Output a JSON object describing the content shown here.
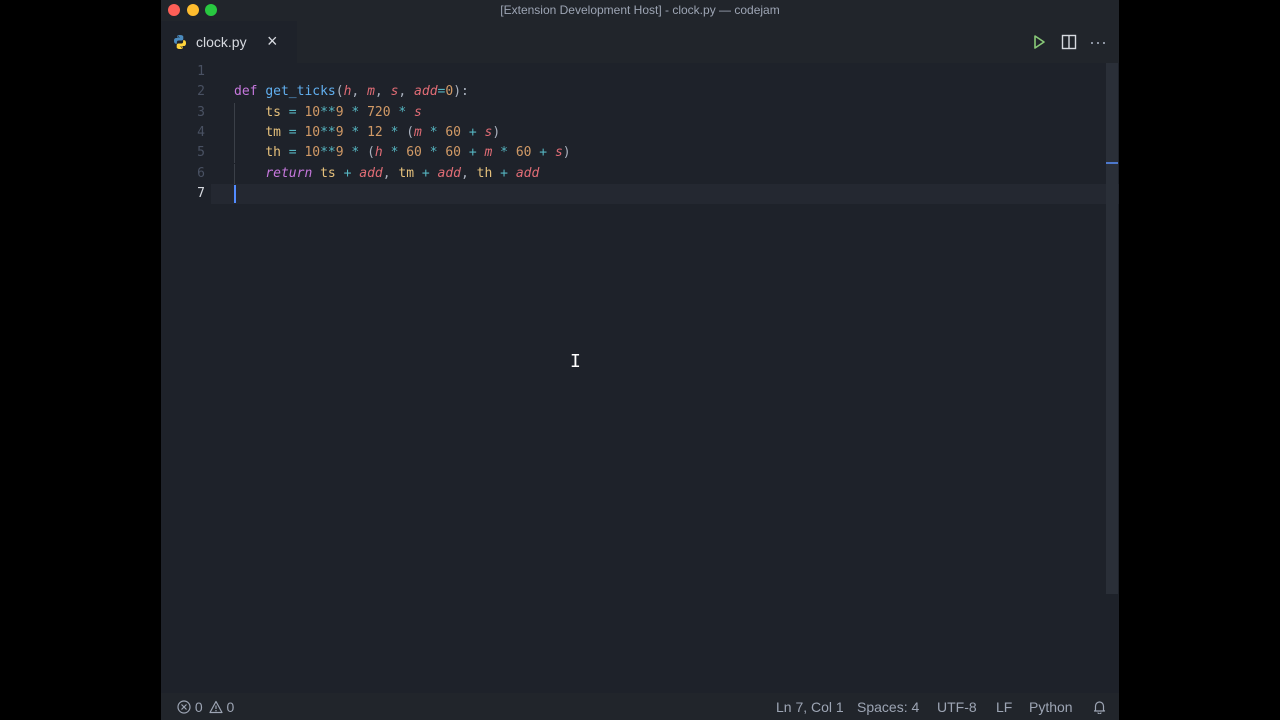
{
  "window": {
    "title": "[Extension Development Host] - clock.py — codejam"
  },
  "tab": {
    "label": "clock.py",
    "close_glyph": "×",
    "icon": "python-icon"
  },
  "toolbar": {
    "run_icon": "run-icon",
    "split_icon": "split-editor-icon",
    "more_glyph": "···"
  },
  "editor": {
    "line_numbers": [
      "1",
      "2",
      "3",
      "4",
      "5",
      "6",
      "7"
    ],
    "active_line": 7,
    "lines": [
      [],
      [
        [
          "kw",
          "def"
        ],
        [
          "pn",
          " "
        ],
        [
          "fn",
          "get_ticks"
        ],
        [
          "pn",
          "("
        ],
        [
          "prm",
          "h"
        ],
        [
          "pn",
          ", "
        ],
        [
          "prm",
          "m"
        ],
        [
          "pn",
          ", "
        ],
        [
          "prm",
          "s"
        ],
        [
          "pn",
          ", "
        ],
        [
          "prm",
          "add"
        ],
        [
          "op",
          "="
        ],
        [
          "nm",
          "0"
        ],
        [
          "pn",
          "):"
        ]
      ],
      [
        [
          "pn",
          "    "
        ],
        [
          "vr",
          "ts"
        ],
        [
          "pn",
          " "
        ],
        [
          "op",
          "="
        ],
        [
          "pn",
          " "
        ],
        [
          "nm",
          "10"
        ],
        [
          "op",
          "**"
        ],
        [
          "nm",
          "9"
        ],
        [
          "pn",
          " "
        ],
        [
          "op",
          "*"
        ],
        [
          "pn",
          " "
        ],
        [
          "nm",
          "720"
        ],
        [
          "pn",
          " "
        ],
        [
          "op",
          "*"
        ],
        [
          "pn",
          " "
        ],
        [
          "prm",
          "s"
        ]
      ],
      [
        [
          "pn",
          "    "
        ],
        [
          "vr",
          "tm"
        ],
        [
          "pn",
          " "
        ],
        [
          "op",
          "="
        ],
        [
          "pn",
          " "
        ],
        [
          "nm",
          "10"
        ],
        [
          "op",
          "**"
        ],
        [
          "nm",
          "9"
        ],
        [
          "pn",
          " "
        ],
        [
          "op",
          "*"
        ],
        [
          "pn",
          " "
        ],
        [
          "nm",
          "12"
        ],
        [
          "pn",
          " "
        ],
        [
          "op",
          "*"
        ],
        [
          "pn",
          " ("
        ],
        [
          "prm",
          "m"
        ],
        [
          "pn",
          " "
        ],
        [
          "op",
          "*"
        ],
        [
          "pn",
          " "
        ],
        [
          "nm",
          "60"
        ],
        [
          "pn",
          " "
        ],
        [
          "op",
          "+"
        ],
        [
          "pn",
          " "
        ],
        [
          "prm",
          "s"
        ],
        [
          "pn",
          ")"
        ]
      ],
      [
        [
          "pn",
          "    "
        ],
        [
          "vr",
          "th"
        ],
        [
          "pn",
          " "
        ],
        [
          "op",
          "="
        ],
        [
          "pn",
          " "
        ],
        [
          "nm",
          "10"
        ],
        [
          "op",
          "**"
        ],
        [
          "nm",
          "9"
        ],
        [
          "pn",
          " "
        ],
        [
          "op",
          "*"
        ],
        [
          "pn",
          " ("
        ],
        [
          "prm",
          "h"
        ],
        [
          "pn",
          " "
        ],
        [
          "op",
          "*"
        ],
        [
          "pn",
          " "
        ],
        [
          "nm",
          "60"
        ],
        [
          "pn",
          " "
        ],
        [
          "op",
          "*"
        ],
        [
          "pn",
          " "
        ],
        [
          "nm",
          "60"
        ],
        [
          "pn",
          " "
        ],
        [
          "op",
          "+"
        ],
        [
          "pn",
          " "
        ],
        [
          "prm",
          "m"
        ],
        [
          "pn",
          " "
        ],
        [
          "op",
          "*"
        ],
        [
          "pn",
          " "
        ],
        [
          "nm",
          "60"
        ],
        [
          "pn",
          " "
        ],
        [
          "op",
          "+"
        ],
        [
          "pn",
          " "
        ],
        [
          "prm",
          "s"
        ],
        [
          "pn",
          ")"
        ]
      ],
      [
        [
          "pn",
          "    "
        ],
        [
          "kw-i",
          "return"
        ],
        [
          "pn",
          " "
        ],
        [
          "vr",
          "ts"
        ],
        [
          "pn",
          " "
        ],
        [
          "op",
          "+"
        ],
        [
          "pn",
          " "
        ],
        [
          "prm",
          "add"
        ],
        [
          "pn",
          ", "
        ],
        [
          "vr",
          "tm"
        ],
        [
          "pn",
          " "
        ],
        [
          "op",
          "+"
        ],
        [
          "pn",
          " "
        ],
        [
          "prm",
          "add"
        ],
        [
          "pn",
          ", "
        ],
        [
          "vr",
          "th"
        ],
        [
          "pn",
          " "
        ],
        [
          "op",
          "+"
        ],
        [
          "pn",
          " "
        ],
        [
          "prm",
          "add"
        ]
      ],
      []
    ]
  },
  "statusbar": {
    "errors": "0",
    "warnings": "0",
    "position": "Ln 7, Col 1",
    "spaces": "Spaces: 4",
    "encoding": "UTF-8",
    "eol": "LF",
    "language": "Python"
  },
  "colors": {
    "keyword": "#c678dd",
    "function": "#61afef",
    "parameter": "#e06c75",
    "variable": "#e5c07b",
    "number": "#d19a66",
    "operator": "#56b6c2",
    "cursor": "#528bff"
  }
}
